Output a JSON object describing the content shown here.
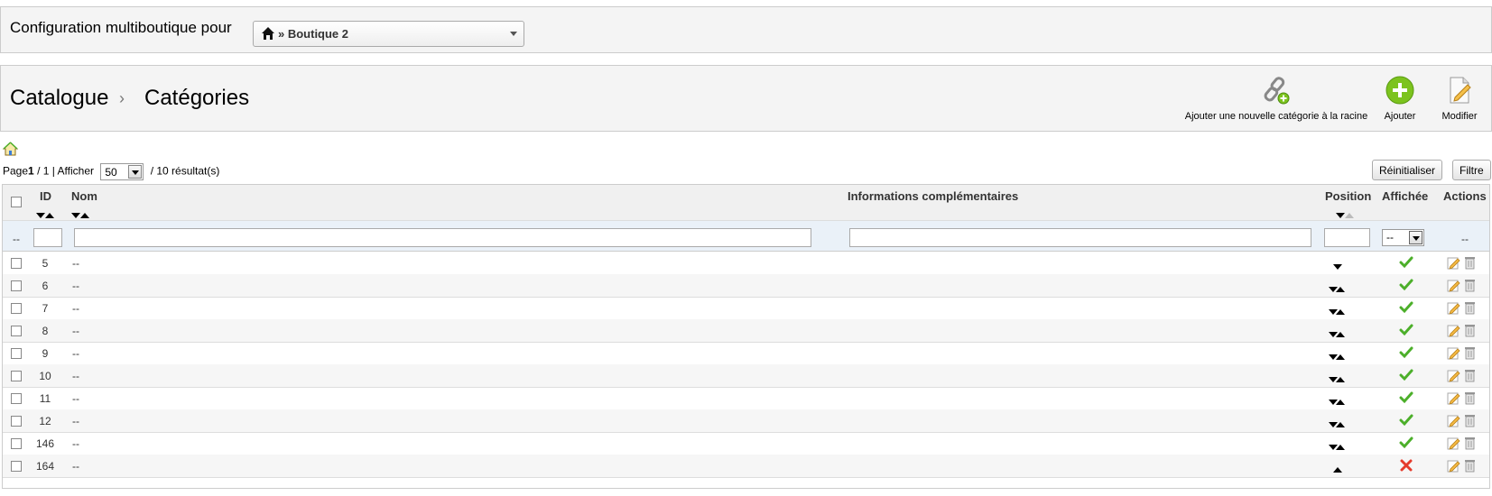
{
  "shop_bar": {
    "label": "Configuration multiboutique pour",
    "selected_shop": "» Boutique 2"
  },
  "toolbar": {
    "breadcrumb_1": "Catalogue",
    "breadcrumb_sep": "›",
    "breadcrumb_2": "Catégories",
    "add_root_label": "Ajouter une nouvelle catégorie à la racine",
    "add_label": "Ajouter",
    "edit_label": "Modifier"
  },
  "pagination": {
    "page_prefix": "Page",
    "page_current": "1",
    "page_suffix": "/ 1 | Afficher",
    "per_page": "50",
    "results": "/ 10 résultat(s)"
  },
  "buttons": {
    "reset": "Réinitialiser",
    "filter": "Filtre"
  },
  "table": {
    "headers": {
      "id": "ID",
      "name": "Nom",
      "info": "Informations complémentaires",
      "position": "Position",
      "displayed": "Affichée",
      "actions": "Actions"
    },
    "filter": {
      "checkbox_dash": "--",
      "displayed_value": "--",
      "actions_dash": "--"
    },
    "rows": [
      {
        "id": "5",
        "name": "--",
        "pos": "down",
        "displayed": true
      },
      {
        "id": "6",
        "name": "--",
        "pos": "both",
        "displayed": true
      },
      {
        "id": "7",
        "name": "--",
        "pos": "both",
        "displayed": true
      },
      {
        "id": "8",
        "name": "--",
        "pos": "both",
        "displayed": true
      },
      {
        "id": "9",
        "name": "--",
        "pos": "both",
        "displayed": true
      },
      {
        "id": "10",
        "name": "--",
        "pos": "both",
        "displayed": true
      },
      {
        "id": "11",
        "name": "--",
        "pos": "both",
        "displayed": true
      },
      {
        "id": "12",
        "name": "--",
        "pos": "both",
        "displayed": true
      },
      {
        "id": "146",
        "name": "--",
        "pos": "both",
        "displayed": true
      },
      {
        "id": "164",
        "name": "--",
        "pos": "up",
        "displayed": false
      }
    ]
  },
  "colors": {
    "check_green": "#4caf2a",
    "cross_red": "#e53b2c",
    "add_green": "#7cc31e"
  }
}
